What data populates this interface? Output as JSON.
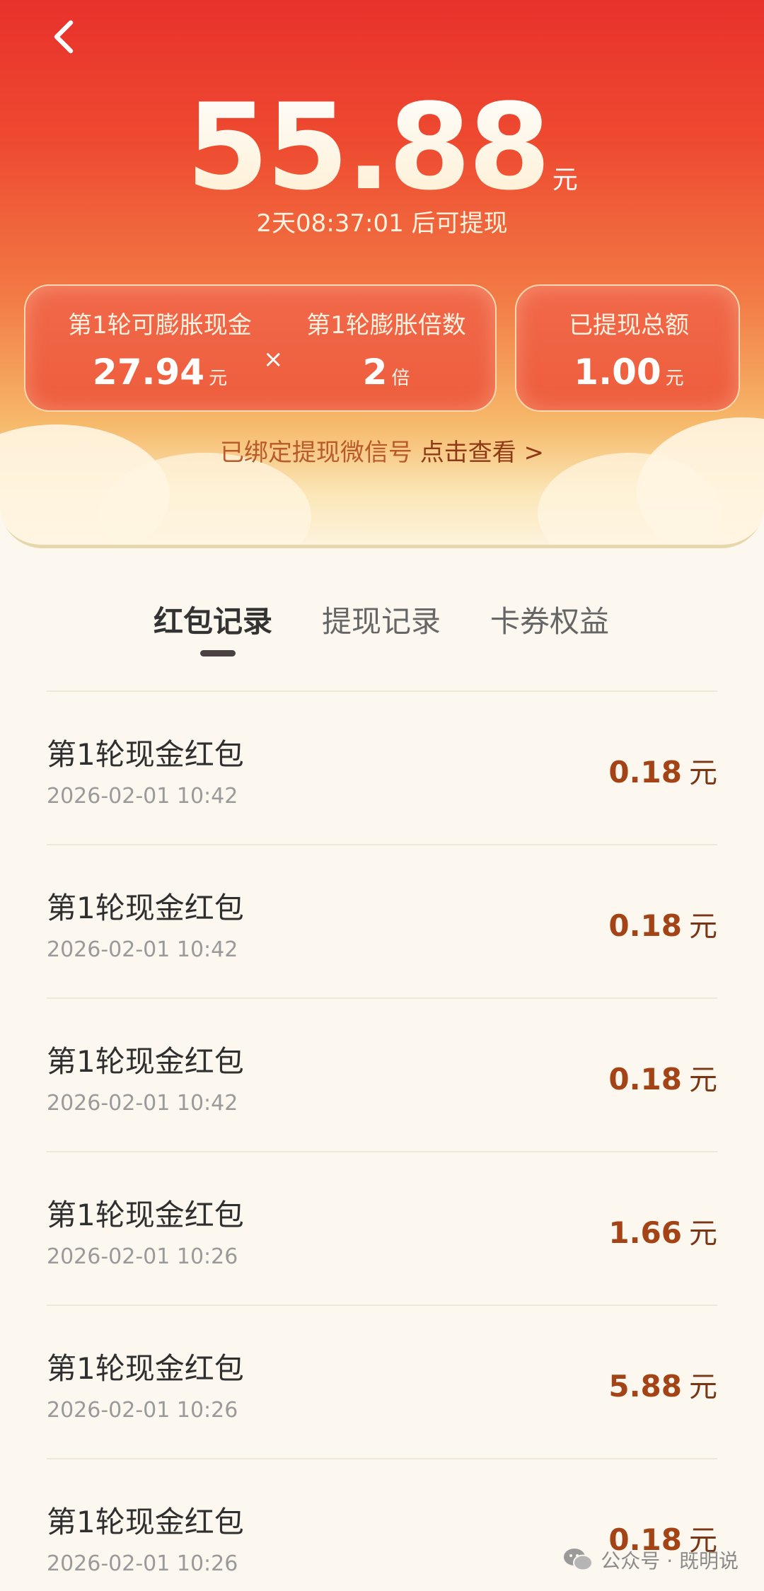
{
  "header": {
    "balance_amount": "55.88",
    "balance_unit": "元",
    "countdown": "2天08:37:01 后可提现"
  },
  "stats": {
    "expand_cash_label": "第1轮可膨胀现金",
    "expand_cash_value": "27.94",
    "expand_cash_unit": "元",
    "times_symbol": "×",
    "multiplier_label": "第1轮膨胀倍数",
    "multiplier_value": "2",
    "multiplier_unit": "倍",
    "withdrawn_label": "已提现总额",
    "withdrawn_value": "1.00",
    "withdrawn_unit": "元"
  },
  "bind": {
    "text": "已绑定提现微信号",
    "link": "点击查看 >"
  },
  "tabs": [
    {
      "label": "红包记录",
      "active": true
    },
    {
      "label": "提现记录",
      "active": false
    },
    {
      "label": "卡券权益",
      "active": false
    }
  ],
  "records": [
    {
      "title": "第1轮现金红包",
      "time": "2026-02-01 10:42",
      "amount": "0.18",
      "unit": "元"
    },
    {
      "title": "第1轮现金红包",
      "time": "2026-02-01 10:42",
      "amount": "0.18",
      "unit": "元"
    },
    {
      "title": "第1轮现金红包",
      "time": "2026-02-01 10:42",
      "amount": "0.18",
      "unit": "元"
    },
    {
      "title": "第1轮现金红包",
      "time": "2026-02-01 10:26",
      "amount": "1.66",
      "unit": "元"
    },
    {
      "title": "第1轮现金红包",
      "time": "2026-02-01 10:26",
      "amount": "5.88",
      "unit": "元"
    },
    {
      "title": "第1轮现金红包",
      "time": "2026-02-01 10:26",
      "amount": "0.18",
      "unit": "元"
    }
  ],
  "watermark": {
    "text": "公众号 · 既明说",
    "icon": "wechat-icon"
  },
  "colors": {
    "header_red": "#e8312c",
    "amount_brown": "#a44316",
    "background": "#fdf8ef"
  }
}
